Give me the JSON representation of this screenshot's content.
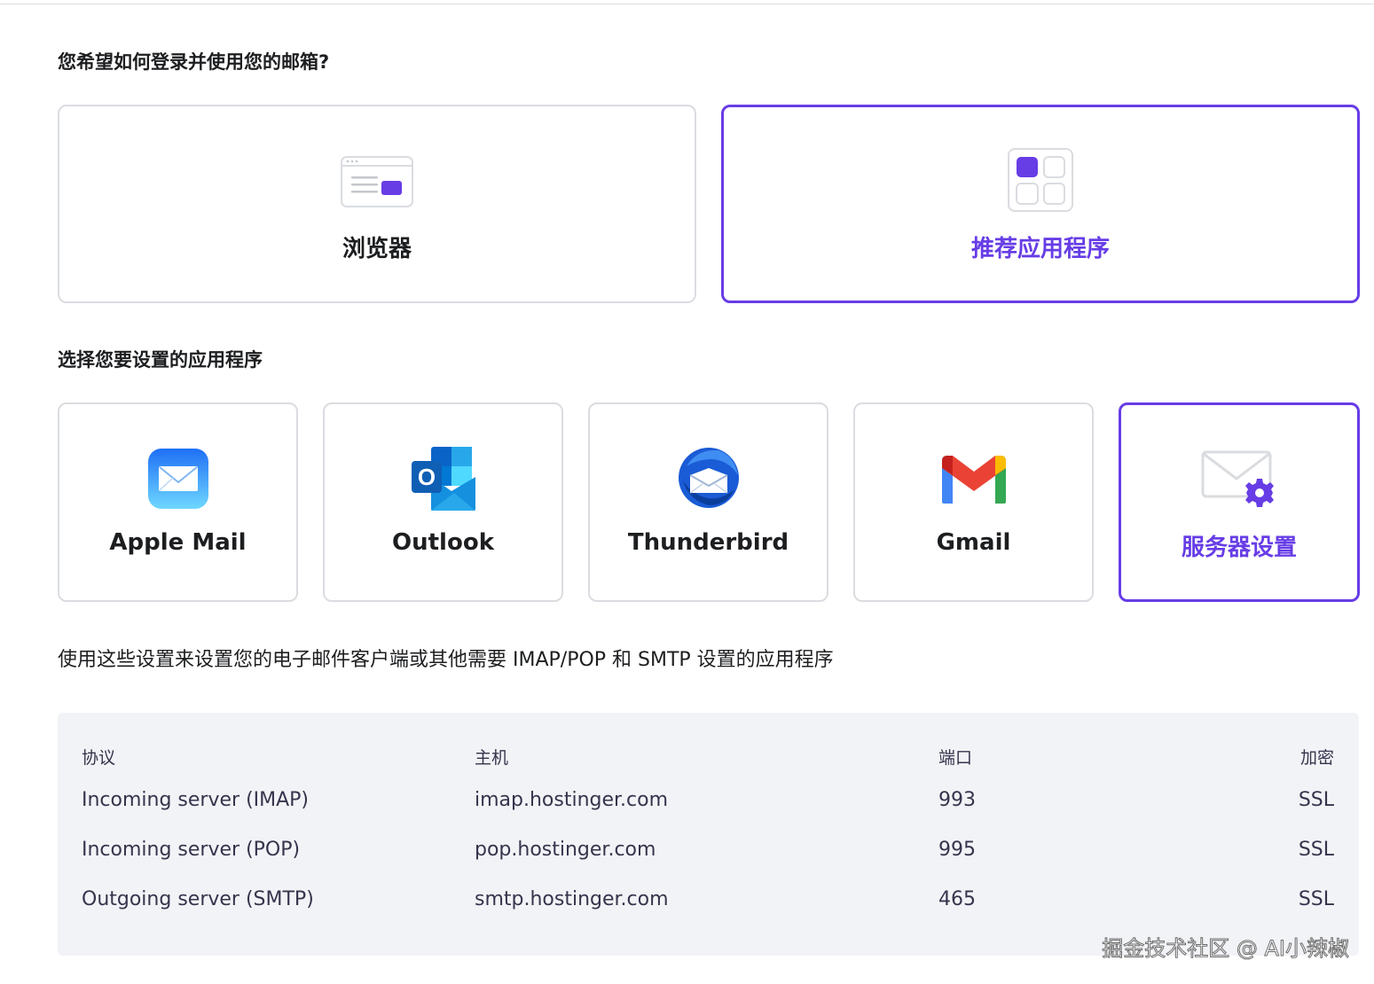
{
  "login": {
    "heading": "您希望如何登录并使用您的邮箱?",
    "options": [
      {
        "label": "浏览器",
        "selected": false
      },
      {
        "label": "推荐应用程序",
        "selected": true
      }
    ]
  },
  "apps": {
    "heading": "选择您要设置的应用程序",
    "items": [
      {
        "label": "Apple Mail",
        "icon": "apple-mail-icon"
      },
      {
        "label": "Outlook",
        "icon": "outlook-icon"
      },
      {
        "label": "Thunderbird",
        "icon": "thunderbird-icon"
      },
      {
        "label": "Gmail",
        "icon": "gmail-icon"
      },
      {
        "label": "服务器设置",
        "icon": "server-settings-icon",
        "selected": true
      }
    ]
  },
  "description": "使用这些设置来设置您的电子邮件客户端或其他需要 IMAP/POP 和 SMTP 设置的应用程序",
  "settings_table": {
    "headers": [
      "协议",
      "主机",
      "端口",
      "加密"
    ],
    "rows": [
      [
        "Incoming server (IMAP)",
        "imap.hostinger.com",
        "993",
        "SSL"
      ],
      [
        "Incoming server (POP)",
        "pop.hostinger.com",
        "995",
        "SSL"
      ],
      [
        "Outgoing server (SMTP)",
        "smtp.hostinger.com",
        "465",
        "SSL"
      ]
    ]
  },
  "watermark": "掘金技术社区 @ AI小辣椒",
  "colors": {
    "accent": "#673de6",
    "border": "#dadce0",
    "panel": "#f2f3f6"
  }
}
